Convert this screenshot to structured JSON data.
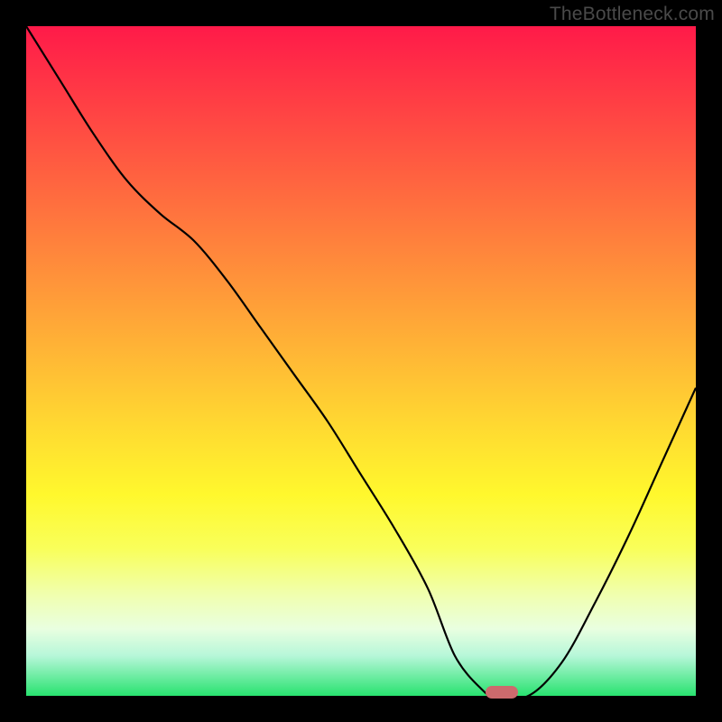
{
  "watermark": "TheBottleneck.com",
  "chart_data": {
    "type": "line",
    "title": "",
    "xlabel": "",
    "ylabel": "",
    "ylim": [
      0,
      100
    ],
    "xlim": [
      0,
      100
    ],
    "series": [
      {
        "name": "bottleneck-curve",
        "x": [
          0,
          5,
          10,
          15,
          20,
          25,
          30,
          35,
          40,
          45,
          50,
          55,
          60,
          64,
          68,
          70,
          75,
          80,
          85,
          90,
          95,
          100
        ],
        "y": [
          100,
          92,
          84,
          77,
          72,
          68,
          62,
          55,
          48,
          41,
          33,
          25,
          16,
          6,
          1,
          0,
          0,
          5,
          14,
          24,
          35,
          46
        ]
      }
    ],
    "marker": {
      "x": 71,
      "y": 0,
      "width_pct": 5,
      "color": "#cc6a6d"
    }
  },
  "colors": {
    "gradient_top": "#ff1a49",
    "gradient_bottom": "#28e26f",
    "curve": "#000000",
    "frame": "#000000"
  }
}
